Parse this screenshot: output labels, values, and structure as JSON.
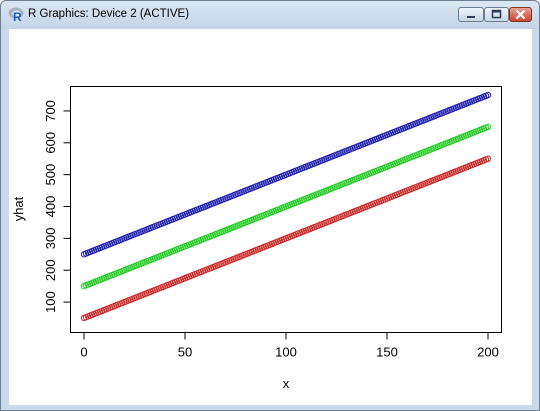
{
  "window": {
    "title": "R Graphics: Device 2 (ACTIVE)",
    "icon": "r-logo-icon",
    "buttons": [
      "minimize-icon",
      "maximize-icon",
      "close-icon"
    ]
  },
  "chart_data": {
    "type": "scatter",
    "title": "",
    "xlabel": "x",
    "ylabel": "yhat",
    "xlim": [
      0,
      200
    ],
    "ylim": [
      50,
      750
    ],
    "x_ticks": [
      "0",
      "50",
      "100",
      "150",
      "200"
    ],
    "y_ticks": [
      "100",
      "200",
      "300",
      "400",
      "500",
      "600",
      "700"
    ],
    "grid": false,
    "marker": "open-circle",
    "x": {
      "from": 0,
      "to": 200,
      "step": 1
    },
    "series": [
      {
        "color": "#2020b0",
        "intercept": 250,
        "slope": 2.5
      },
      {
        "color": "#22cc22",
        "intercept": 150,
        "slope": 2.5
      },
      {
        "color": "#cc2a2a",
        "intercept": 50,
        "slope": 2.5
      }
    ]
  }
}
